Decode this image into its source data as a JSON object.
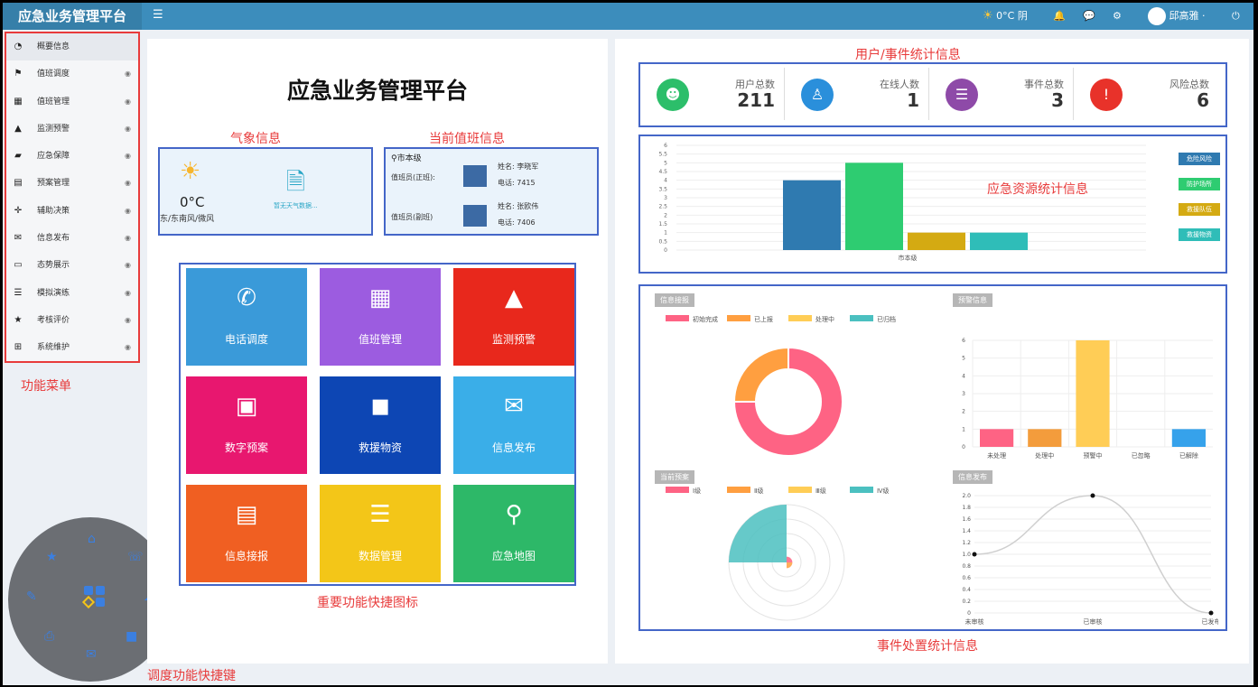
{
  "app": {
    "title": "应急业务管理平台",
    "menu_icon": "hamburger-icon"
  },
  "topbar": {
    "weather": "0°C 阴",
    "user": "邱高雅 ·"
  },
  "menu": {
    "caption": "功能菜单",
    "items": [
      {
        "label": "概要信息",
        "icon": "dashboard-icon"
      },
      {
        "label": "值班调度",
        "icon": "flag-icon"
      },
      {
        "label": "值班管理",
        "icon": "calendar-icon"
      },
      {
        "label": "监测预警",
        "icon": "warning-icon"
      },
      {
        "label": "应急保障",
        "icon": "truck-icon"
      },
      {
        "label": "预案管理",
        "icon": "card-icon"
      },
      {
        "label": "辅助决策",
        "icon": "arrows-icon"
      },
      {
        "label": "信息发布",
        "icon": "envelope-icon"
      },
      {
        "label": "态势展示",
        "icon": "monitor-icon"
      },
      {
        "label": "模拟演练",
        "icon": "server-icon"
      },
      {
        "label": "考核评价",
        "icon": "star-icon"
      },
      {
        "label": "系统维护",
        "icon": "sitemap-icon"
      }
    ]
  },
  "left": {
    "title": "应急业务管理平台",
    "weather_caption": "气象信息",
    "duty_caption": "当前值班信息",
    "weather": {
      "temp": "0°C",
      "wind": "东/东南风/微风",
      "note": "暂无天气数据..."
    },
    "duty": {
      "org": "市本级",
      "rows": [
        {
          "role": "值班员(正班):",
          "name_label": "姓名: 李晓军",
          "phone_label": "电话: 7415"
        },
        {
          "role": "值班员(副班)",
          "name_label": "姓名: 张欧伟",
          "phone_label": "电话: 7406"
        }
      ]
    },
    "tiles_caption": "重要功能快捷图标",
    "tiles": [
      {
        "label": "电话调度",
        "color": "#3a9ad9"
      },
      {
        "label": "值班管理",
        "color": "#9c5ce0"
      },
      {
        "label": "监测预警",
        "color": "#e8281c"
      },
      {
        "label": "数字预案",
        "color": "#e8176f"
      },
      {
        "label": "救援物资",
        "color": "#0d46b4"
      },
      {
        "label": "信息发布",
        "color": "#3aaee8"
      },
      {
        "label": "信息接报",
        "color": "#f05f22"
      },
      {
        "label": "数据管理",
        "color": "#f3c618"
      },
      {
        "label": "应急地图",
        "color": "#2db868"
      }
    ],
    "shortcut_caption": "调度功能快捷键"
  },
  "right": {
    "stats_caption": "用户/事件统计信息",
    "stats": [
      {
        "label": "用户总数",
        "value": "211",
        "color": "#2cbe6a"
      },
      {
        "label": "在线人数",
        "value": "1",
        "color": "#2a8fdb"
      },
      {
        "label": "事件总数",
        "value": "3",
        "color": "#8e4aa8"
      },
      {
        "label": "风险总数",
        "value": "6",
        "color": "#e8322a"
      }
    ],
    "resource_caption": "应急资源统计信息",
    "event_caption": "事件处置统计信息",
    "resource_legend": [
      {
        "label": "危险风险",
        "color": "#2f7ab0"
      },
      {
        "label": "防护场所",
        "color": "#2ecc71"
      },
      {
        "label": "救援队伍",
        "color": "#d4aa12"
      },
      {
        "label": "救援物资",
        "color": "#2fbdb8"
      }
    ],
    "chart_tags": {
      "report": "信息接报",
      "warning": "预警信息",
      "plan": "当前预案",
      "publish": "信息发布"
    }
  },
  "chart_data": [
    {
      "type": "bar",
      "categories": [
        "市本级"
      ],
      "series": [
        {
          "name": "危险风险",
          "values": [
            4
          ]
        },
        {
          "name": "防护场所",
          "values": [
            5
          ]
        },
        {
          "name": "救援队伍",
          "values": [
            1
          ]
        },
        {
          "name": "救援物资",
          "values": [
            1
          ]
        }
      ],
      "ylim": [
        0,
        6
      ],
      "yticks": [
        "0",
        "0.5",
        "1",
        "1.5",
        "2",
        "2.5",
        "3",
        "3.5",
        "4",
        "4.5",
        "5",
        "5.5",
        "6"
      ]
    },
    {
      "type": "pie",
      "labels": [
        "初始完成",
        "已上报",
        "处理中",
        "已归档"
      ],
      "values": [
        3,
        1,
        0,
        0
      ],
      "colors": [
        "#fe6384",
        "#ff9f40",
        "#ffcd56",
        "#4bc0c0"
      ]
    },
    {
      "type": "bar",
      "categories": [
        "未处理",
        "处理中",
        "预警中",
        "已忽略",
        "已解除"
      ],
      "values": [
        1,
        1,
        6,
        0,
        1
      ],
      "colors": [
        "#fe6384",
        "#f39c3c",
        "#ffcd56",
        "#4bc0c0",
        "#36a2eb"
      ],
      "ylim": [
        0,
        6
      ],
      "yticks": [
        "0",
        "1",
        "2",
        "3",
        "4",
        "5",
        "6"
      ]
    },
    {
      "type": "pie",
      "labels": [
        "Ⅰ级",
        "Ⅱ级",
        "Ⅲ级",
        "Ⅳ级"
      ],
      "values": [
        0.3,
        0.3,
        0,
        3
      ],
      "colors": [
        "#fe6384",
        "#ff9f40",
        "#ffcd56",
        "#4bc0c0"
      ]
    },
    {
      "type": "line",
      "categories": [
        "未审核",
        "已审核",
        "已发布"
      ],
      "values": [
        1,
        2,
        0
      ],
      "ylim": [
        0,
        2
      ],
      "yticks": [
        "0",
        "0.2",
        "0.4",
        "0.6",
        "0.8",
        "1.0",
        "1.2",
        "1.4",
        "1.6",
        "1.8",
        "2.0"
      ]
    }
  ]
}
